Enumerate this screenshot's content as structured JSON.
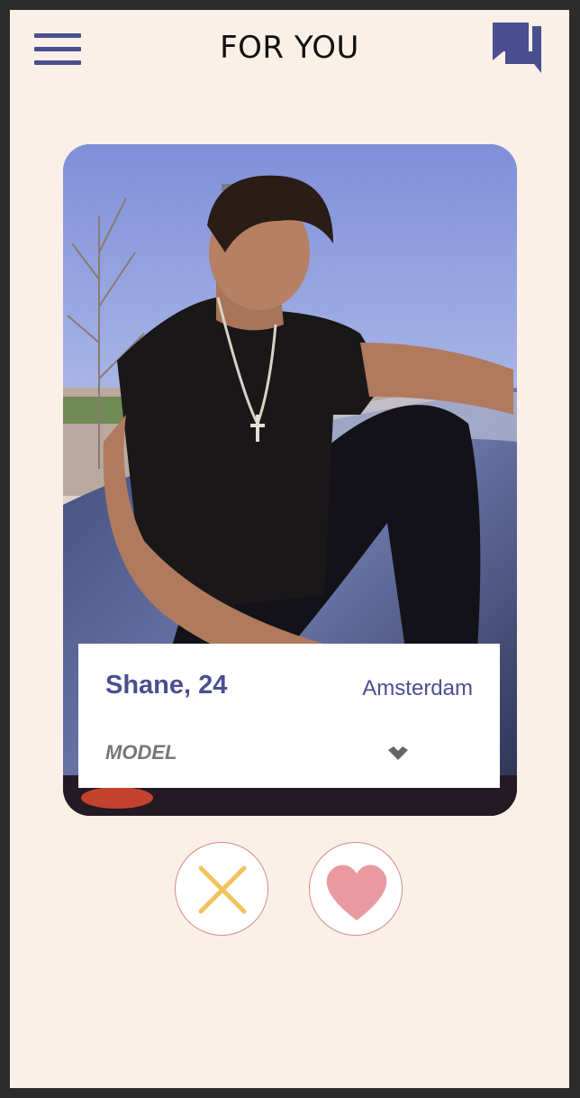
{
  "header": {
    "title": "FOR YOU",
    "menu_icon": "hamburger-menu-icon",
    "chat_icon": "chat-bubbles-icon"
  },
  "profile": {
    "name_age": "Shane, 24",
    "city": "Amsterdam",
    "occupation": "MODEL",
    "expand_icon": "chevron-down-icon",
    "photo": "profile-photo"
  },
  "actions": {
    "reject_icon": "x-icon",
    "like_icon": "heart-icon"
  },
  "colors": {
    "background": "#faf0e8",
    "accent": "#4a4f8f",
    "reject": "#f0c45a",
    "like": "#e89aa0",
    "action_border": "#d98a8a"
  }
}
